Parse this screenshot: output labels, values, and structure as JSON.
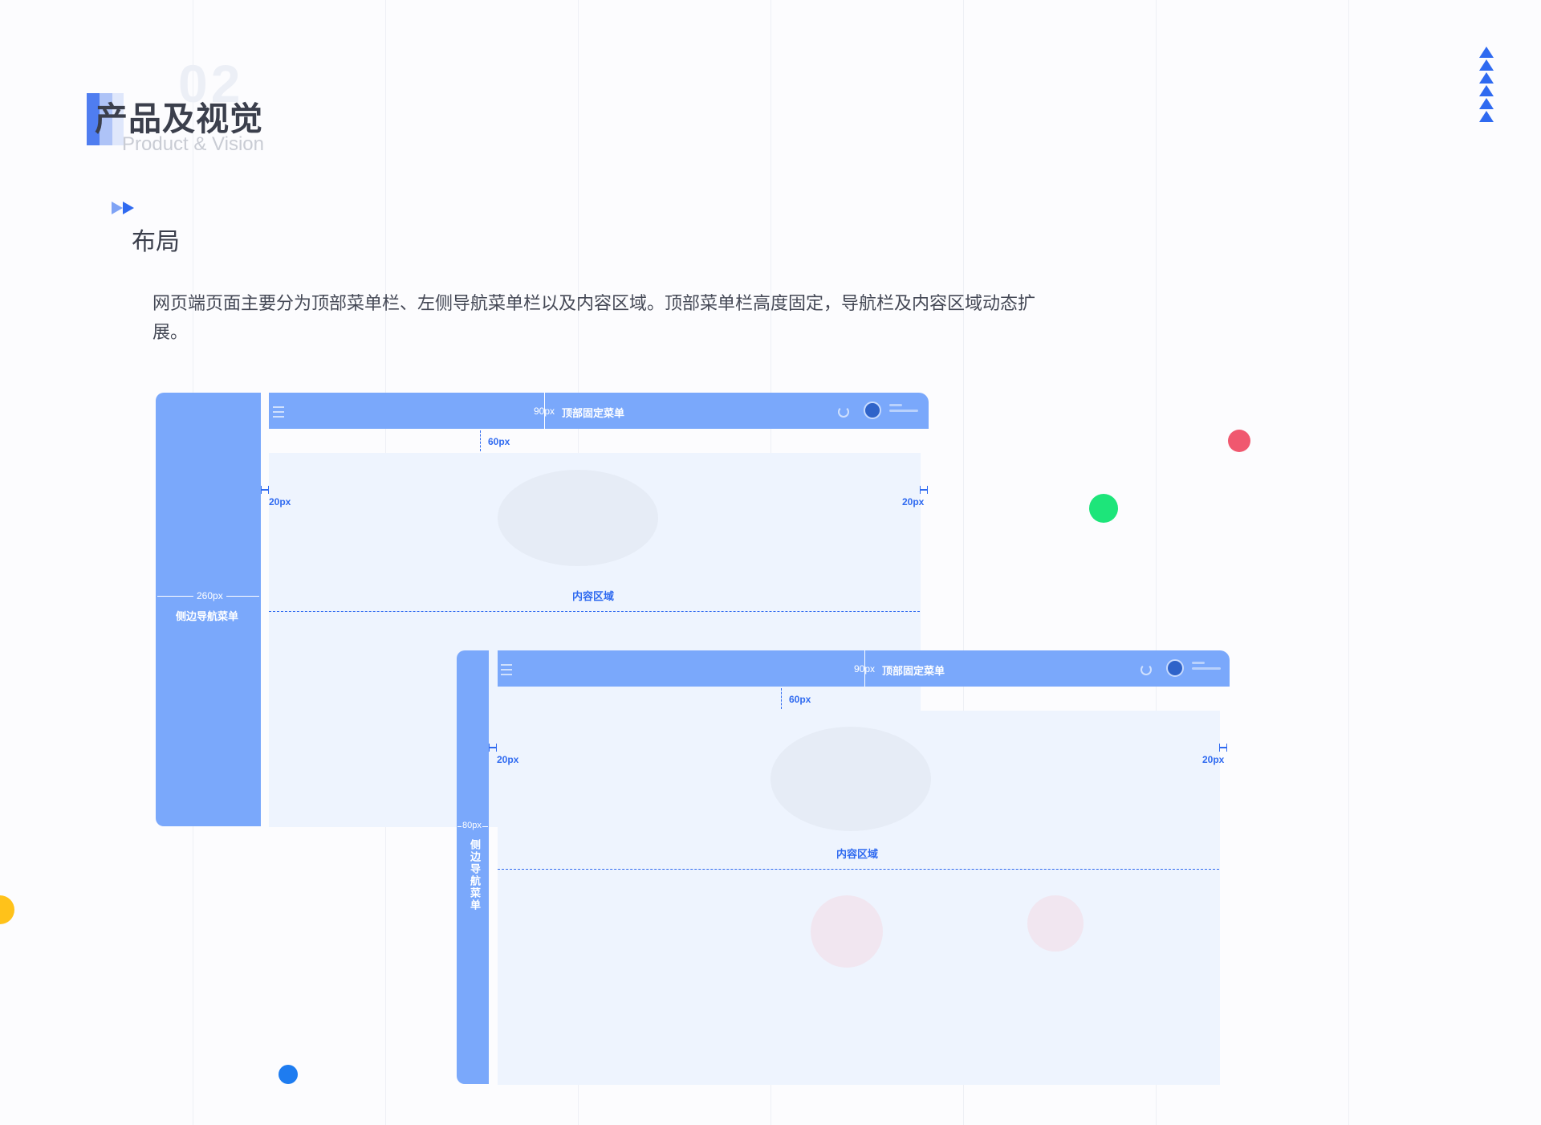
{
  "header": {
    "number": "02",
    "title": "产品及视觉",
    "subtitle": "Product & Vision"
  },
  "section": {
    "title": "布局",
    "description": "网页端页面主要分为顶部菜单栏、左侧导航菜单栏以及内容区域。顶部菜单栏高度固定，导航栏及内容区域动态扩展。"
  },
  "layout_expanded": {
    "top_height_label": "90px",
    "top_menu_label": "顶部固定菜单",
    "gap_label": "60px",
    "left_pad_label": "20px",
    "right_pad_label": "20px",
    "side_width_label": "260px",
    "side_menu_label": "侧边导航菜单",
    "content_label": "内容区域"
  },
  "layout_collapsed": {
    "top_height_label": "90px",
    "top_menu_label": "顶部固定菜单",
    "gap_label": "60px",
    "left_pad_label": "20px",
    "right_pad_label": "20px",
    "side_width_label": "80px",
    "side_menu_label": "侧边导航菜单",
    "content_label": "内容区域"
  },
  "colors": {
    "accent": "#2f6af0",
    "panel": "#7aa8fb",
    "content_bg": "#eef4fe",
    "dot_red": "#f0586f",
    "dot_green": "#1de57a",
    "dot_yellow": "#ffc21a",
    "dot_blue": "#1e7cf0"
  }
}
